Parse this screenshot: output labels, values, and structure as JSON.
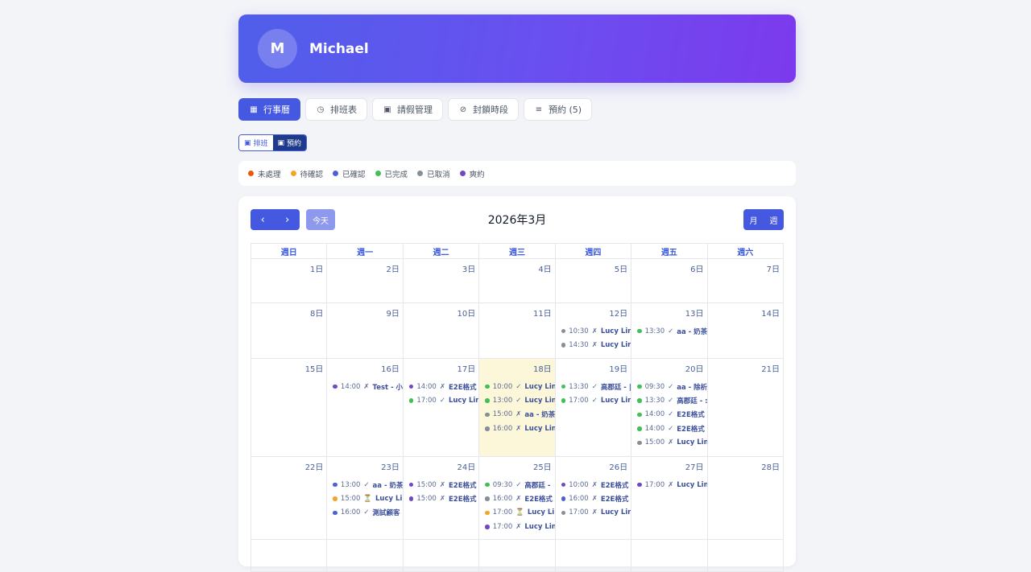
{
  "user": {
    "initial": "M",
    "name": "Michael"
  },
  "tabs": [
    {
      "icon": "calendar-icon",
      "glyph": "▦",
      "label": "行事曆",
      "active": true
    },
    {
      "icon": "clock-icon",
      "glyph": "◷",
      "label": "排班表",
      "active": false
    },
    {
      "icon": "leave-icon",
      "glyph": "▣",
      "label": "請假管理",
      "active": false
    },
    {
      "icon": "lock-check-icon",
      "glyph": "⊘",
      "label": "封鎖時段",
      "active": false
    },
    {
      "icon": "list-icon",
      "glyph": "≡",
      "label": "預約 (5)",
      "active": false
    }
  ],
  "segment": {
    "schedule": "排班",
    "booking": "預約",
    "selected": "預約"
  },
  "legend": [
    {
      "label": "未處理",
      "color": "#e8590c"
    },
    {
      "label": "待確認",
      "color": "#f5a524"
    },
    {
      "label": "已確認",
      "color": "#4c5fd5"
    },
    {
      "label": "已完成",
      "color": "#40c057"
    },
    {
      "label": "已取消",
      "color": "#868e96"
    },
    {
      "label": "爽約",
      "color": "#7048c6"
    }
  ],
  "calendar": {
    "title": "2026年3月",
    "prev": "‹",
    "next": "›",
    "today_label": "今天",
    "view_month": "月",
    "view_week": "週",
    "weekdays": [
      "週日",
      "週一",
      "週二",
      "週三",
      "週四",
      "週五",
      "週六"
    ],
    "today_date": "18日",
    "weeks": [
      [
        {
          "d": "1日",
          "ev": []
        },
        {
          "d": "2日",
          "ev": []
        },
        {
          "d": "3日",
          "ev": []
        },
        {
          "d": "4日",
          "ev": []
        },
        {
          "d": "5日",
          "ev": []
        },
        {
          "d": "6日",
          "ev": []
        },
        {
          "d": "7日",
          "ev": []
        }
      ],
      [
        {
          "d": "8日",
          "ev": []
        },
        {
          "d": "9日",
          "ev": []
        },
        {
          "d": "10日",
          "ev": []
        },
        {
          "d": "11日",
          "ev": []
        },
        {
          "d": "12日",
          "ev": [
            {
              "t": "10:30",
              "m": "✗",
              "n": "Lucy Lin",
              "c": "#868e96"
            },
            {
              "t": "14:30",
              "m": "✗",
              "n": "Lucy Lin",
              "c": "#868e96"
            }
          ]
        },
        {
          "d": "13日",
          "ev": [
            {
              "t": "13:30",
              "m": "✓",
              "n": "aa - 奶茶",
              "c": "#40c057"
            }
          ]
        },
        {
          "d": "14日",
          "ev": []
        }
      ],
      [
        {
          "d": "15日",
          "ev": []
        },
        {
          "d": "16日",
          "ev": [
            {
              "t": "14:00",
              "m": "✗",
              "n": "Test - 小",
              "c": "#7048c6"
            }
          ]
        },
        {
          "d": "17日",
          "ev": [
            {
              "t": "14:00",
              "m": "✗",
              "n": "E2E格式",
              "c": "#7048c6"
            },
            {
              "t": "17:00",
              "m": "✓",
              "n": "Lucy Lin",
              "c": "#40c057"
            }
          ]
        },
        {
          "d": "18日",
          "ev": [
            {
              "t": "10:00",
              "m": "✓",
              "n": "Lucy Lin",
              "c": "#40c057"
            },
            {
              "t": "13:00",
              "m": "✓",
              "n": "Lucy Lin",
              "c": "#40c057"
            },
            {
              "t": "15:00",
              "m": "✗",
              "n": "aa - 奶茶",
              "c": "#868e96"
            },
            {
              "t": "16:00",
              "m": "✗",
              "n": "Lucy Lin",
              "c": "#868e96"
            }
          ]
        },
        {
          "d": "19日",
          "ev": [
            {
              "t": "13:30",
              "m": "✓",
              "n": "高郡廷 - |",
              "c": "#40c057"
            },
            {
              "t": "17:00",
              "m": "✓",
              "n": "Lucy Lin",
              "c": "#40c057"
            }
          ]
        },
        {
          "d": "20日",
          "ev": [
            {
              "t": "09:30",
              "m": "✓",
              "n": "aa - 除析",
              "c": "#40c057"
            },
            {
              "t": "13:30",
              "m": "✓",
              "n": "高郡廷 - :",
              "c": "#40c057"
            },
            {
              "t": "14:00",
              "m": "✓",
              "n": "E2E格式",
              "c": "#40c057"
            },
            {
              "t": "14:00",
              "m": "✓",
              "n": "E2E格式",
              "c": "#40c057"
            },
            {
              "t": "15:00",
              "m": "✗",
              "n": "Lucy Lin",
              "c": "#868e96"
            }
          ]
        },
        {
          "d": "21日",
          "ev": []
        }
      ],
      [
        {
          "d": "22日",
          "ev": []
        },
        {
          "d": "23日",
          "ev": [
            {
              "t": "13:00",
              "m": "✓",
              "n": "aa - 奶茶",
              "c": "#4c5fd5"
            },
            {
              "t": "15:00",
              "m": "⏳",
              "n": "Lucy Li",
              "c": "#f5a524"
            },
            {
              "t": "16:00",
              "m": "✓",
              "n": "測試顧客",
              "c": "#4c5fd5"
            }
          ]
        },
        {
          "d": "24日",
          "ev": [
            {
              "t": "15:00",
              "m": "✗",
              "n": "E2E格式",
              "c": "#7048c6"
            },
            {
              "t": "15:00",
              "m": "✗",
              "n": "E2E格式",
              "c": "#7048c6"
            }
          ]
        },
        {
          "d": "25日",
          "ev": [
            {
              "t": "09:30",
              "m": "✓",
              "n": "高郡廷 -",
              "c": "#40c057"
            },
            {
              "t": "16:00",
              "m": "✗",
              "n": "E2E格式",
              "c": "#868e96"
            },
            {
              "t": "17:00",
              "m": "⏳",
              "n": "Lucy Li",
              "c": "#f5a524"
            },
            {
              "t": "17:00",
              "m": "✗",
              "n": "Lucy Lin",
              "c": "#7048c6"
            }
          ]
        },
        {
          "d": "26日",
          "ev": [
            {
              "t": "10:00",
              "m": "✗",
              "n": "E2E格式",
              "c": "#7048c6"
            },
            {
              "t": "16:00",
              "m": "✗",
              "n": "E2E格式",
              "c": "#4c5fd5"
            },
            {
              "t": "17:00",
              "m": "✗",
              "n": "Lucy Lin",
              "c": "#868e96"
            }
          ]
        },
        {
          "d": "27日",
          "ev": [
            {
              "t": "17:00",
              "m": "✗",
              "n": "Lucy Lin",
              "c": "#7048c6"
            }
          ]
        },
        {
          "d": "28日",
          "ev": []
        }
      ],
      [
        {
          "d": "",
          "ev": []
        },
        {
          "d": "",
          "ev": []
        },
        {
          "d": "",
          "ev": []
        },
        {
          "d": "",
          "ev": []
        },
        {
          "d": "",
          "ev": []
        },
        {
          "d": "",
          "ev": []
        },
        {
          "d": "",
          "ev": []
        }
      ]
    ]
  }
}
